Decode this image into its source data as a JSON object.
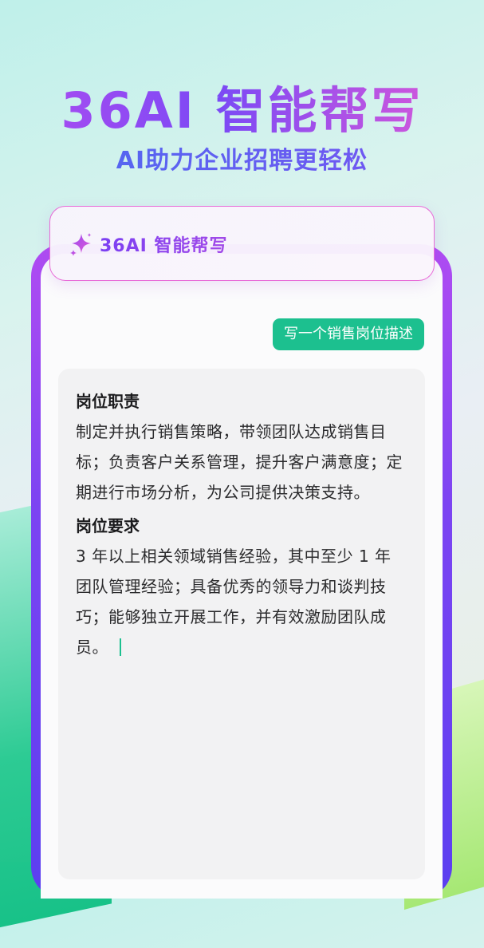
{
  "hero": {
    "title": "36AI 智能帮写",
    "subtitle": "AI助力企业招聘更轻松"
  },
  "app_header": {
    "icon": "sparkle-icon",
    "brand": "36AI 智能帮写"
  },
  "prompt": {
    "text": "写一个销售岗位描述"
  },
  "answer": {
    "section1_title": "岗位职责",
    "section1_body": "制定并执行销售策略，带领团队达成销售目标；负责客户关系管理，提升客户满意度；定期进行市场分析，为公司提供决策支持。",
    "section2_title": "岗位要求",
    "section2_body": "3 年以上相关领域销售经验，其中至少 1 年团队管理经验；具备优秀的领导力和谈判技巧；能够独立开展工作，并有效激励团队成员。"
  },
  "colors": {
    "accent_green": "#1cc08f",
    "brand_purple": "#7b3ff2",
    "brand_pink": "#e45ad6"
  }
}
